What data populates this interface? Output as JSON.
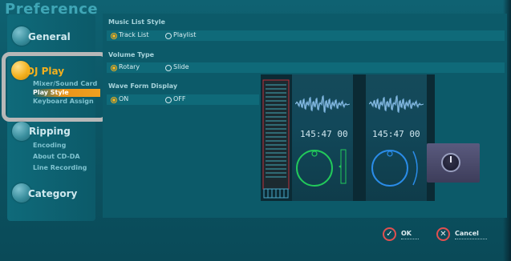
{
  "app": {
    "title": "Preference"
  },
  "nav": {
    "sections": [
      {
        "label": "General",
        "active": false,
        "items": []
      },
      {
        "label": "DJ Play",
        "active": true,
        "items": [
          {
            "label": "Mixer/Sound Card",
            "active": false
          },
          {
            "label": "Play Style",
            "active": true
          },
          {
            "label": "Keyboard Assign",
            "active": false
          }
        ]
      },
      {
        "label": "Ripping",
        "active": false,
        "items": [
          {
            "label": "Encoding",
            "active": false
          },
          {
            "label": "About CD-DA",
            "active": false
          },
          {
            "label": "Line Recording",
            "active": false
          }
        ]
      },
      {
        "label": "Category",
        "active": false,
        "items": []
      }
    ]
  },
  "settings": {
    "music_list_style": {
      "label": "Music List Style",
      "options": [
        "Track List",
        "Playlist"
      ],
      "selected": "Track List"
    },
    "volume_type": {
      "label": "Volume Type",
      "options": [
        "Rotary",
        "Slide"
      ],
      "selected": "Rotary"
    },
    "wave_form_display": {
      "label": "Wave Form Display",
      "options": [
        "ON",
        "OFF"
      ],
      "selected": "ON"
    }
  },
  "preview": {
    "deck_a_time": "145:47 00",
    "deck_b_time": "145:47 00"
  },
  "footer": {
    "ok_label": "OK",
    "cancel_label": "Cancel"
  },
  "colors": {
    "accent": "#f2b01e",
    "active_bar": "#e8941a",
    "background": "#0c5a69",
    "deck_a": "#22c95a",
    "deck_b": "#2a8ce8",
    "button_ring": "#e05050"
  }
}
